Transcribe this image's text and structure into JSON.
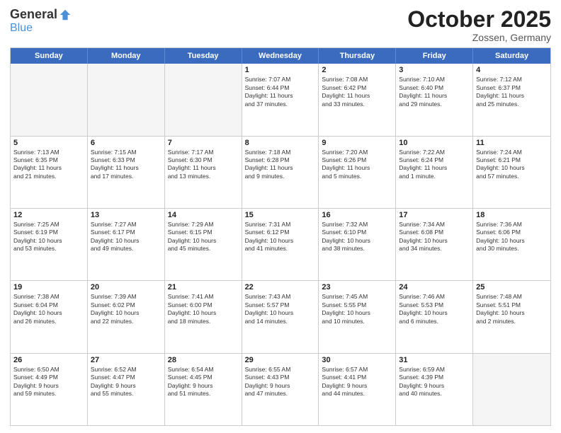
{
  "logo": {
    "general": "General",
    "blue": "Blue"
  },
  "header": {
    "title": "October 2025",
    "location": "Zossen, Germany"
  },
  "weekdays": [
    "Sunday",
    "Monday",
    "Tuesday",
    "Wednesday",
    "Thursday",
    "Friday",
    "Saturday"
  ],
  "weeks": [
    [
      {
        "day": "",
        "info": ""
      },
      {
        "day": "",
        "info": ""
      },
      {
        "day": "",
        "info": ""
      },
      {
        "day": "1",
        "info": "Sunrise: 7:07 AM\nSunset: 6:44 PM\nDaylight: 11 hours\nand 37 minutes."
      },
      {
        "day": "2",
        "info": "Sunrise: 7:08 AM\nSunset: 6:42 PM\nDaylight: 11 hours\nand 33 minutes."
      },
      {
        "day": "3",
        "info": "Sunrise: 7:10 AM\nSunset: 6:40 PM\nDaylight: 11 hours\nand 29 minutes."
      },
      {
        "day": "4",
        "info": "Sunrise: 7:12 AM\nSunset: 6:37 PM\nDaylight: 11 hours\nand 25 minutes."
      }
    ],
    [
      {
        "day": "5",
        "info": "Sunrise: 7:13 AM\nSunset: 6:35 PM\nDaylight: 11 hours\nand 21 minutes."
      },
      {
        "day": "6",
        "info": "Sunrise: 7:15 AM\nSunset: 6:33 PM\nDaylight: 11 hours\nand 17 minutes."
      },
      {
        "day": "7",
        "info": "Sunrise: 7:17 AM\nSunset: 6:30 PM\nDaylight: 11 hours\nand 13 minutes."
      },
      {
        "day": "8",
        "info": "Sunrise: 7:18 AM\nSunset: 6:28 PM\nDaylight: 11 hours\nand 9 minutes."
      },
      {
        "day": "9",
        "info": "Sunrise: 7:20 AM\nSunset: 6:26 PM\nDaylight: 11 hours\nand 5 minutes."
      },
      {
        "day": "10",
        "info": "Sunrise: 7:22 AM\nSunset: 6:24 PM\nDaylight: 11 hours\nand 1 minute."
      },
      {
        "day": "11",
        "info": "Sunrise: 7:24 AM\nSunset: 6:21 PM\nDaylight: 10 hours\nand 57 minutes."
      }
    ],
    [
      {
        "day": "12",
        "info": "Sunrise: 7:25 AM\nSunset: 6:19 PM\nDaylight: 10 hours\nand 53 minutes."
      },
      {
        "day": "13",
        "info": "Sunrise: 7:27 AM\nSunset: 6:17 PM\nDaylight: 10 hours\nand 49 minutes."
      },
      {
        "day": "14",
        "info": "Sunrise: 7:29 AM\nSunset: 6:15 PM\nDaylight: 10 hours\nand 45 minutes."
      },
      {
        "day": "15",
        "info": "Sunrise: 7:31 AM\nSunset: 6:12 PM\nDaylight: 10 hours\nand 41 minutes."
      },
      {
        "day": "16",
        "info": "Sunrise: 7:32 AM\nSunset: 6:10 PM\nDaylight: 10 hours\nand 38 minutes."
      },
      {
        "day": "17",
        "info": "Sunrise: 7:34 AM\nSunset: 6:08 PM\nDaylight: 10 hours\nand 34 minutes."
      },
      {
        "day": "18",
        "info": "Sunrise: 7:36 AM\nSunset: 6:06 PM\nDaylight: 10 hours\nand 30 minutes."
      }
    ],
    [
      {
        "day": "19",
        "info": "Sunrise: 7:38 AM\nSunset: 6:04 PM\nDaylight: 10 hours\nand 26 minutes."
      },
      {
        "day": "20",
        "info": "Sunrise: 7:39 AM\nSunset: 6:02 PM\nDaylight: 10 hours\nand 22 minutes."
      },
      {
        "day": "21",
        "info": "Sunrise: 7:41 AM\nSunset: 6:00 PM\nDaylight: 10 hours\nand 18 minutes."
      },
      {
        "day": "22",
        "info": "Sunrise: 7:43 AM\nSunset: 5:57 PM\nDaylight: 10 hours\nand 14 minutes."
      },
      {
        "day": "23",
        "info": "Sunrise: 7:45 AM\nSunset: 5:55 PM\nDaylight: 10 hours\nand 10 minutes."
      },
      {
        "day": "24",
        "info": "Sunrise: 7:46 AM\nSunset: 5:53 PM\nDaylight: 10 hours\nand 6 minutes."
      },
      {
        "day": "25",
        "info": "Sunrise: 7:48 AM\nSunset: 5:51 PM\nDaylight: 10 hours\nand 2 minutes."
      }
    ],
    [
      {
        "day": "26",
        "info": "Sunrise: 6:50 AM\nSunset: 4:49 PM\nDaylight: 9 hours\nand 59 minutes."
      },
      {
        "day": "27",
        "info": "Sunrise: 6:52 AM\nSunset: 4:47 PM\nDaylight: 9 hours\nand 55 minutes."
      },
      {
        "day": "28",
        "info": "Sunrise: 6:54 AM\nSunset: 4:45 PM\nDaylight: 9 hours\nand 51 minutes."
      },
      {
        "day": "29",
        "info": "Sunrise: 6:55 AM\nSunset: 4:43 PM\nDaylight: 9 hours\nand 47 minutes."
      },
      {
        "day": "30",
        "info": "Sunrise: 6:57 AM\nSunset: 4:41 PM\nDaylight: 9 hours\nand 44 minutes."
      },
      {
        "day": "31",
        "info": "Sunrise: 6:59 AM\nSunset: 4:39 PM\nDaylight: 9 hours\nand 40 minutes."
      },
      {
        "day": "",
        "info": ""
      }
    ]
  ]
}
